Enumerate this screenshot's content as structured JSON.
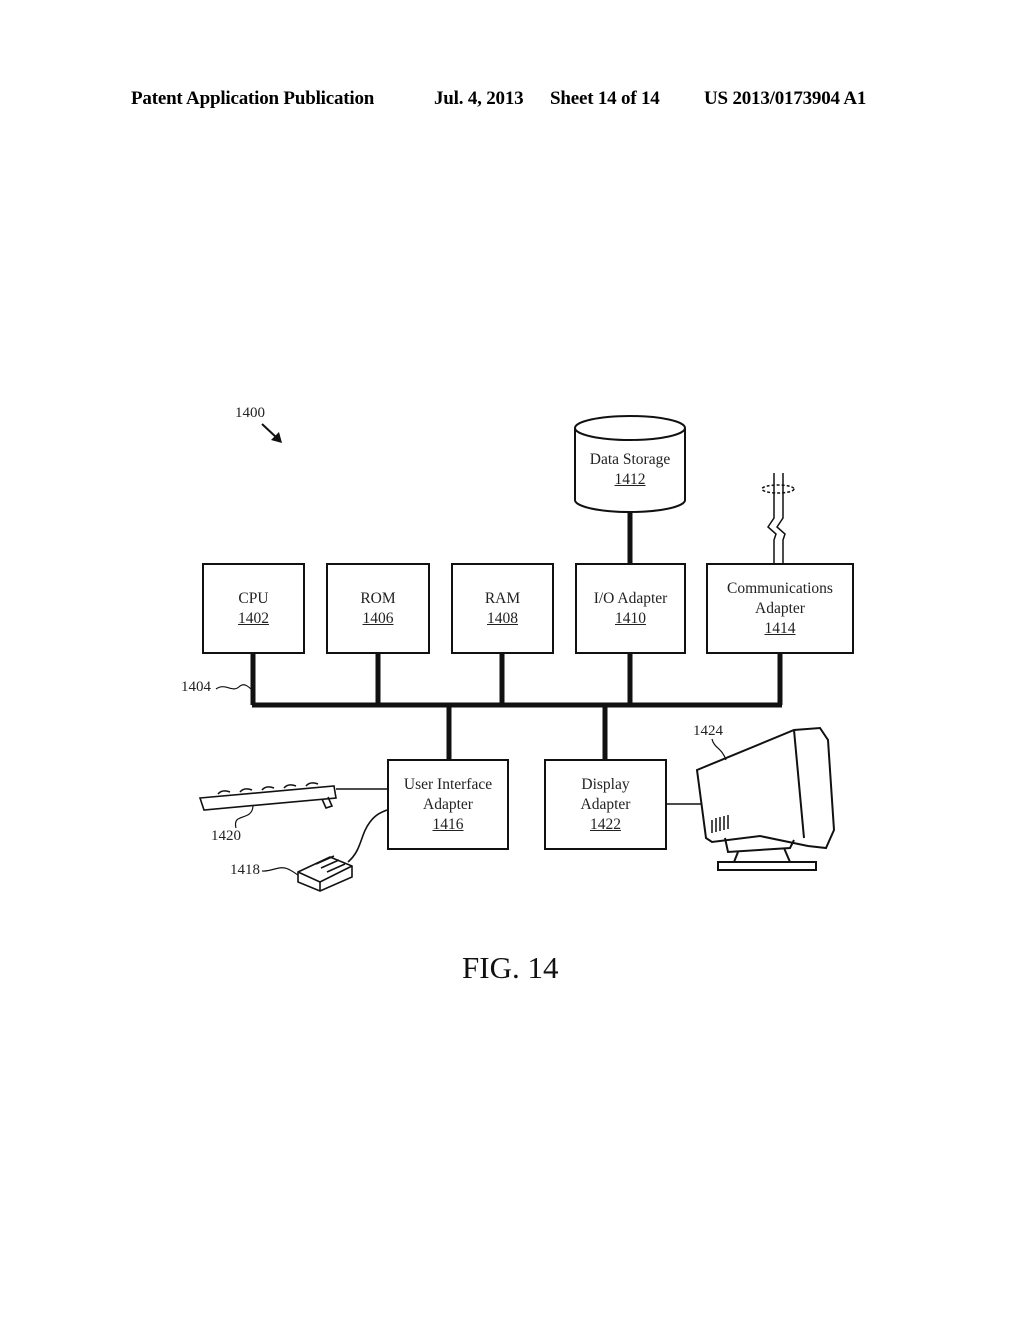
{
  "header": {
    "publication": "Patent Application Publication",
    "date": "Jul. 4, 2013",
    "sheet": "Sheet 14 of 14",
    "patent_number": "US 2013/0173904 A1"
  },
  "diagram": {
    "system_ref": "1400",
    "bus_ref": "1404",
    "components": {
      "cpu": {
        "label": "CPU",
        "ref": "1402"
      },
      "rom": {
        "label": "ROM",
        "ref": "1406"
      },
      "ram": {
        "label": "RAM",
        "ref": "1408"
      },
      "io_adapter": {
        "label": "I/O Adapter",
        "ref": "1410"
      },
      "comm_adapter": {
        "label_line1": "Communications",
        "label_line2": "Adapter",
        "ref": "1414"
      },
      "data_storage": {
        "label": "Data Storage",
        "ref": "1412"
      },
      "ui_adapter": {
        "label_line1": "User Interface",
        "label_line2": "Adapter",
        "ref": "1416"
      },
      "display_adapter": {
        "label_line1": "Display",
        "label_line2": "Adapter",
        "ref": "1422"
      }
    },
    "peripherals": {
      "mouse_ref": "1418",
      "keyboard_ref": "1420",
      "monitor_ref": "1424"
    }
  },
  "figure_caption": "FIG. 14"
}
